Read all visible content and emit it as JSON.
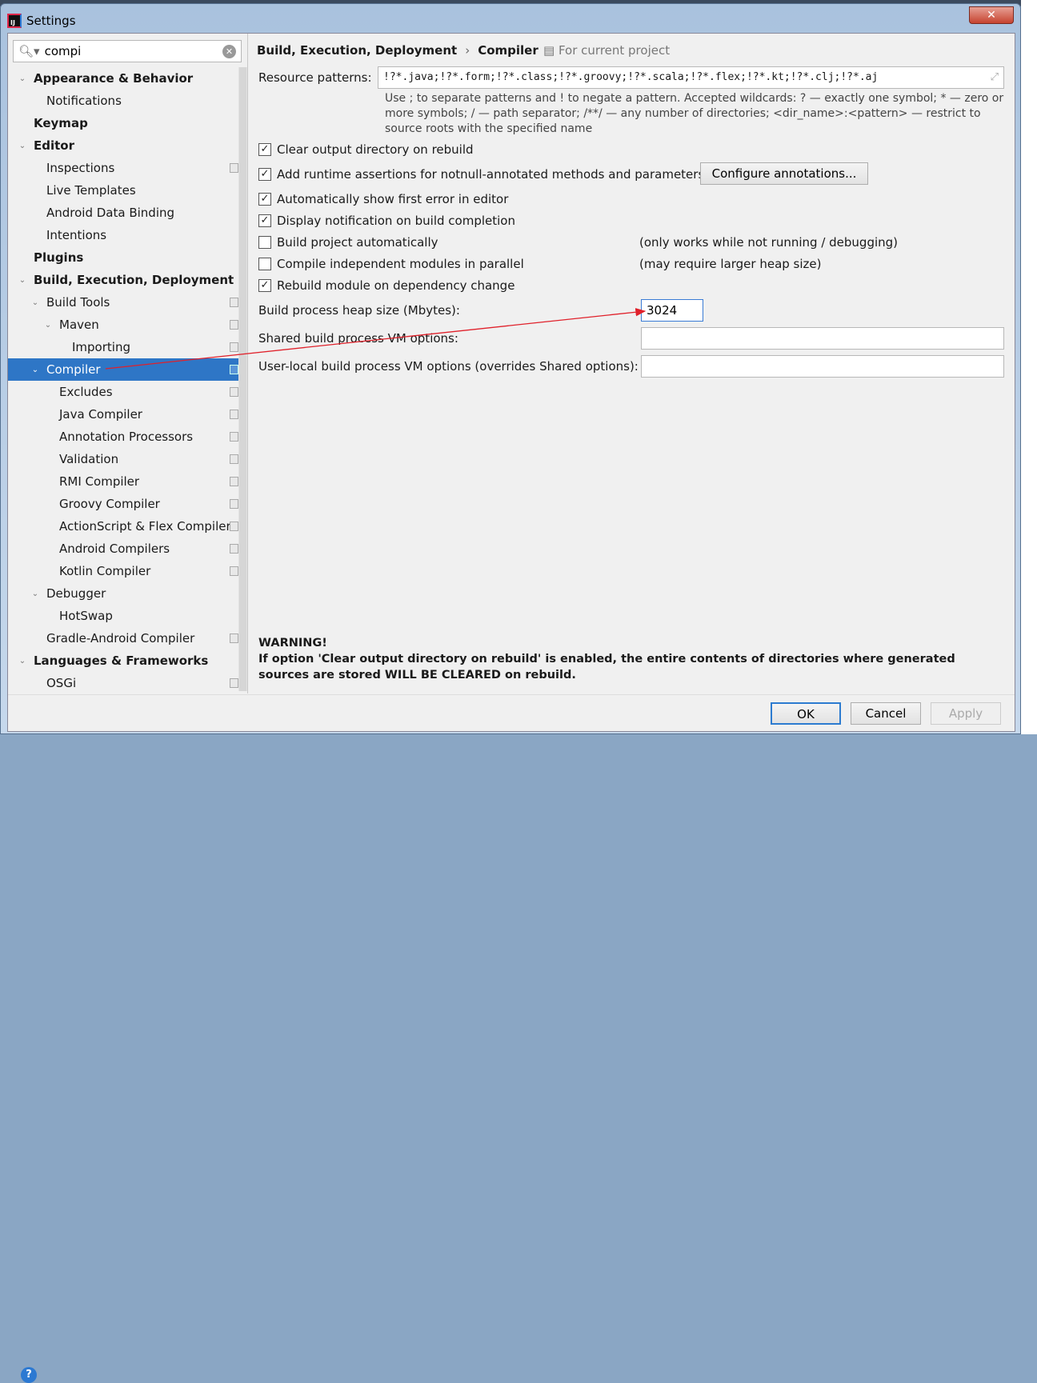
{
  "window": {
    "title": "Settings"
  },
  "search": {
    "value": "compi"
  },
  "tree": [
    {
      "label": "Appearance & Behavior",
      "level": 0,
      "bold": true,
      "arrow": "v"
    },
    {
      "label": "Notifications",
      "level": 1
    },
    {
      "label": "Keymap",
      "level": 0,
      "bold": true
    },
    {
      "label": "Editor",
      "level": 0,
      "bold": true,
      "arrow": "v"
    },
    {
      "label": "Inspections",
      "level": 1,
      "proj": true
    },
    {
      "label": "Live Templates",
      "level": 1
    },
    {
      "label": "Android Data Binding",
      "level": 1
    },
    {
      "label": "Intentions",
      "level": 1
    },
    {
      "label": "Plugins",
      "level": 0,
      "bold": true
    },
    {
      "label": "Build, Execution, Deployment",
      "level": 0,
      "bold": true,
      "arrow": "v"
    },
    {
      "label": "Build Tools",
      "level": 1,
      "arrow": "v",
      "proj": true
    },
    {
      "label": "Maven",
      "level": 2,
      "arrow": "v",
      "proj": true
    },
    {
      "label": "Importing",
      "level": 3,
      "proj": true
    },
    {
      "label": "Compiler",
      "level": 1,
      "arrow": "v",
      "proj": true,
      "selected": true
    },
    {
      "label": "Excludes",
      "level": 2,
      "proj": true
    },
    {
      "label": "Java Compiler",
      "level": 2,
      "proj": true
    },
    {
      "label": "Annotation Processors",
      "level": 2,
      "proj": true
    },
    {
      "label": "Validation",
      "level": 2,
      "proj": true
    },
    {
      "label": "RMI Compiler",
      "level": 2,
      "proj": true
    },
    {
      "label": "Groovy Compiler",
      "level": 2,
      "proj": true
    },
    {
      "label": "ActionScript & Flex Compiler",
      "level": 2,
      "proj": true
    },
    {
      "label": "Android Compilers",
      "level": 2,
      "proj": true
    },
    {
      "label": "Kotlin Compiler",
      "level": 2,
      "proj": true
    },
    {
      "label": "Debugger",
      "level": 1,
      "arrow": "v"
    },
    {
      "label": "HotSwap",
      "level": 2
    },
    {
      "label": "Gradle-Android Compiler",
      "level": 1,
      "proj": true
    },
    {
      "label": "Languages & Frameworks",
      "level": 0,
      "bold": true,
      "arrow": "v"
    },
    {
      "label": "OSGi",
      "level": 1,
      "proj": true
    }
  ],
  "main": {
    "breadcrumb": [
      "Build, Execution, Deployment",
      "Compiler"
    ],
    "breadcrumb_sep": "›",
    "for_project": "For current project",
    "resource_label": "Resource patterns:",
    "resource_value": "!?*.java;!?*.form;!?*.class;!?*.groovy;!?*.scala;!?*.flex;!?*.kt;!?*.clj;!?*.aj",
    "hint": "Use ; to separate patterns and ! to negate a pattern. Accepted wildcards: ? — exactly one symbol; * — zero or more symbols; / — path separator; /**/ — any number of directories; <dir_name>:<pattern> — restrict to source roots with the specified name",
    "checkboxes": [
      {
        "label": "Clear output directory on rebuild",
        "checked": true
      },
      {
        "label": "Add runtime assertions for notnull-annotated methods and parameters",
        "checked": true
      },
      {
        "label": "Automatically show first error in editor",
        "checked": true
      },
      {
        "label": "Display notification on build completion",
        "checked": true
      },
      {
        "label": "Build project automatically",
        "checked": false,
        "note": "(only works while not running / debugging)"
      },
      {
        "label": "Compile independent modules in parallel",
        "checked": false,
        "note": "(may require larger heap size)"
      },
      {
        "label": "Rebuild module on dependency change",
        "checked": true
      }
    ],
    "configure_button": "Configure annotations...",
    "heap_label": "Build process heap size (Mbytes):",
    "heap_value": "3024",
    "shared_vm_label": "Shared build process VM options:",
    "shared_vm_value": "",
    "user_vm_label": "User-local build process VM options (overrides Shared options):",
    "user_vm_value": "",
    "warning_title": "WARNING!",
    "warning_text": "If option 'Clear output directory on rebuild' is enabled, the entire contents of directories where generated sources are stored WILL BE CLEARED on rebuild."
  },
  "footer": {
    "ok": "OK",
    "cancel": "Cancel",
    "apply": "Apply",
    "help": "?"
  },
  "colors": {
    "selection": "#2e76c6",
    "annotation_arrow": "#e0202a"
  }
}
